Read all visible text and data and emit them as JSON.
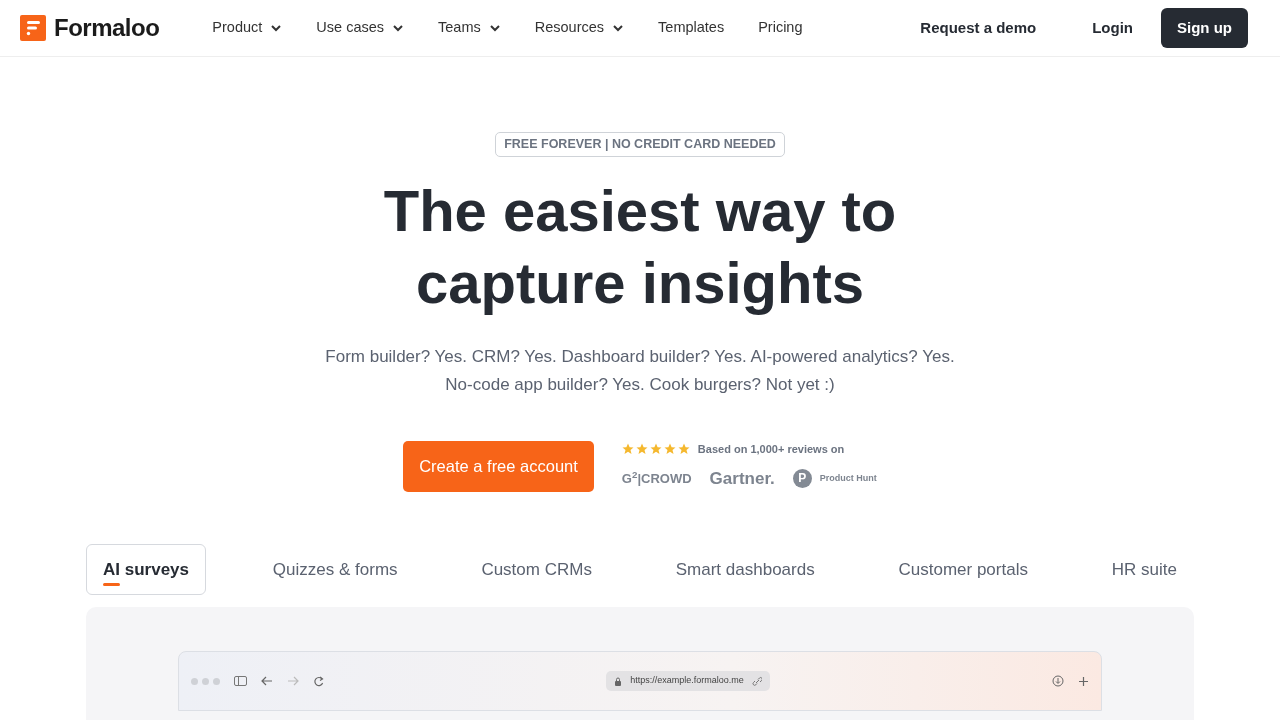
{
  "brand": {
    "name": "Formaloo"
  },
  "nav": [
    {
      "label": "Product",
      "dropdown": true
    },
    {
      "label": "Use cases",
      "dropdown": true
    },
    {
      "label": "Teams",
      "dropdown": true
    },
    {
      "label": "Resources",
      "dropdown": true
    },
    {
      "label": "Templates",
      "dropdown": false
    },
    {
      "label": "Pricing",
      "dropdown": false
    }
  ],
  "actions": {
    "demo": "Request a demo",
    "login": "Login",
    "signup": "Sign up"
  },
  "hero": {
    "badge": "FREE FOREVER | NO CREDIT CARD NEEDED",
    "title": "The easiest way to capture insights",
    "subtitle": "Form builder? Yes. CRM? Yes. Dashboard builder? Yes. AI-powered analytics? Yes. No-code app builder? Yes. Cook burgers? Not yet :)",
    "cta": "Create a free account"
  },
  "reviews": {
    "stars": 5,
    "text": "Based on 1,000+ reviews on",
    "logos": [
      {
        "kind": "g2",
        "text": "G$^{2}$|CROWD"
      },
      {
        "kind": "wordmark",
        "text": "Gartner."
      },
      {
        "kind": "circle",
        "mark": "P",
        "text": "Product Hunt"
      }
    ]
  },
  "tabs": [
    {
      "label": "AI surveys",
      "selected": true
    },
    {
      "label": "Quizzes & forms",
      "selected": false
    },
    {
      "label": "Custom CRMs",
      "selected": false
    },
    {
      "label": "Smart dashboards",
      "selected": false
    },
    {
      "label": "Customer portals",
      "selected": false
    },
    {
      "label": "HR suite",
      "selected": false
    }
  ],
  "browser": {
    "url": "https://example.formaloo.me"
  }
}
